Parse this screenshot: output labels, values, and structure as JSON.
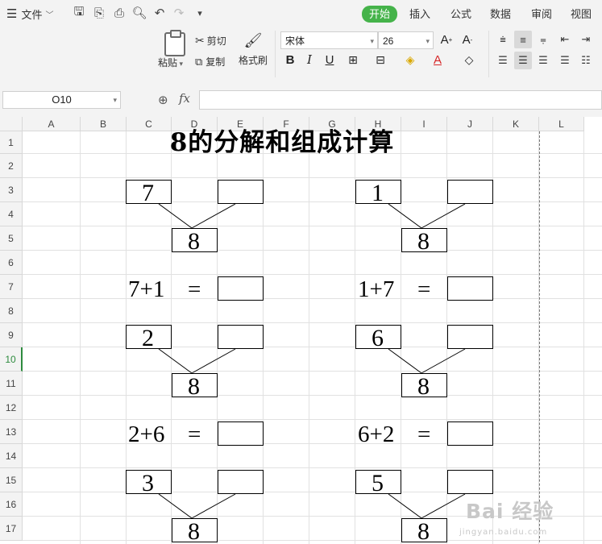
{
  "menu": {
    "file_label": "文件",
    "tabs": [
      {
        "label": "开始",
        "active": true
      },
      {
        "label": "插入"
      },
      {
        "label": "公式"
      },
      {
        "label": "数据"
      },
      {
        "label": "审阅"
      },
      {
        "label": "视图"
      }
    ]
  },
  "ribbon": {
    "paste_label": "粘贴",
    "cut_label": "剪切",
    "copy_label": "复制",
    "format_painter_label": "格式刷",
    "font_name": "宋体",
    "font_size": "26"
  },
  "formula_bar": {
    "cell_ref": "O10",
    "formula": ""
  },
  "grid": {
    "columns": [
      "A",
      "B",
      "C",
      "D",
      "E",
      "F",
      "G",
      "H",
      "I",
      "J",
      "K",
      "L"
    ],
    "rows": [
      "1",
      "2",
      "3",
      "4",
      "5",
      "6",
      "7",
      "8",
      "9",
      "10",
      "11",
      "12",
      "13",
      "14",
      "15",
      "16",
      "17"
    ],
    "active_row": "10"
  },
  "sheet": {
    "title": "8的分解和组成计算",
    "left": {
      "tops": [
        "7",
        "2",
        "3"
      ],
      "bottom": "8",
      "eq1": "7+1",
      "eq2": "2+6",
      "equals": "="
    },
    "right": {
      "tops": [
        "1",
        "6",
        "5"
      ],
      "bottom": "8",
      "eq1": "1+7",
      "eq2": "6+2",
      "equals": "="
    }
  },
  "watermark": {
    "line1": "Bai 经验",
    "line2": "jingyan.baidu.com"
  },
  "colors": {
    "accent": "#45b34a",
    "active_row": "#2e8b3e"
  }
}
